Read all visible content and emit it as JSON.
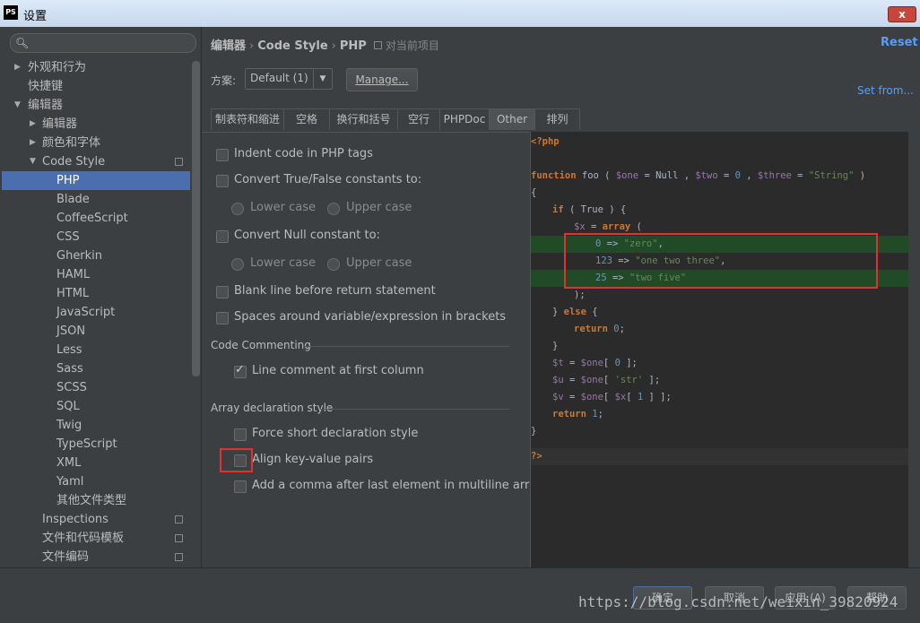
{
  "window": {
    "title": "设置",
    "app_icon": "PS",
    "close_label": "x"
  },
  "sidebar": {
    "search_placeholder": "",
    "items": [
      {
        "label": "外观和行为",
        "arrow": "▶"
      },
      {
        "label": "快捷键"
      },
      {
        "label": "编辑器",
        "arrow": "▼"
      },
      {
        "label": "编辑器",
        "arrow": "▶"
      },
      {
        "label": "颜色和字体",
        "arrow": "▶"
      },
      {
        "label": "Code Style",
        "arrow": "▼"
      },
      {
        "label": "PHP"
      },
      {
        "label": "Blade"
      },
      {
        "label": "CoffeeScript"
      },
      {
        "label": "CSS"
      },
      {
        "label": "Gherkin"
      },
      {
        "label": "HAML"
      },
      {
        "label": "HTML"
      },
      {
        "label": "JavaScript"
      },
      {
        "label": "JSON"
      },
      {
        "label": "Less"
      },
      {
        "label": "Sass"
      },
      {
        "label": "SCSS"
      },
      {
        "label": "SQL"
      },
      {
        "label": "Twig"
      },
      {
        "label": "TypeScript"
      },
      {
        "label": "XML"
      },
      {
        "label": "Yaml"
      },
      {
        "label": "其他文件类型"
      },
      {
        "label": "Inspections"
      },
      {
        "label": "文件和代码模板"
      },
      {
        "label": "文件编码"
      }
    ]
  },
  "header": {
    "crumb1": "编辑器",
    "crumb2": "Code Style",
    "crumb3": "PHP",
    "project": "对当前项目",
    "reset": "Reset",
    "scheme_label": "方案:",
    "scheme_value": "Default (1)",
    "manage": "Manage...",
    "set_from": "Set from..."
  },
  "tabs": [
    "制表符和缩进",
    "空格",
    "换行和括号",
    "空行",
    "PHPDoc",
    "Other",
    "排列"
  ],
  "options": {
    "indent_php_tags": "Indent code in PHP tags",
    "convert_true_false": "Convert True/False constants to:",
    "lower_case": "Lower case",
    "upper_case": "Upper case",
    "convert_null": "Convert Null constant to:",
    "blank_line_return": "Blank line before return statement",
    "spaces_around": "Spaces around variable/expression in brackets",
    "code_commenting": "Code Commenting",
    "line_comment_first": "Line comment at first column",
    "array_decl_style": "Array declaration style",
    "force_short": "Force short declaration style",
    "align_kv": "Align key-value pairs",
    "add_comma": "Add a comma after last element in multiline array"
  },
  "code": {
    "open_tag": "<?php",
    "close_tag": "?>",
    "l_function": "function",
    "l_foo": " foo ( ",
    "l_one": "$one",
    "l_eq_null": " = Null , ",
    "l_two": "$two",
    "l_eq0": " = ",
    "l_0a": "0",
    "l_comma": " , ",
    "l_three": "$three",
    "l_eq": " = ",
    "l_strS": "\"String\"",
    "l_close": " )",
    "brace_open": "{",
    "brace_close": "}",
    "l_if": "if",
    "l_if_cond": " ( True ) {",
    "l_x": "$x",
    "l_arr_eq": " = ",
    "l_array": "array",
    "l_paren": " (",
    "k0": "0",
    "k123": "123",
    "k25": "25",
    "arrow": " => ",
    "s_zero": "\"zero\"",
    "s_onetwothree": "\"one two three\"",
    "s_twofive": "\"two five\"",
    "comma": ",",
    "l_close_arr": ");",
    "l_else_pre": "} ",
    "l_else": "else",
    "l_else_post": " {",
    "l_return": "return",
    "l_ret0_num": "0",
    "semi": ";",
    "l_inner_close": "}",
    "l_t": "$t",
    "l_u": "$u",
    "l_v": "$v",
    "l_one_b": "$one",
    "l_idx0_pre": "[ ",
    "l_idx0": "0",
    "l_idx_post": " ];",
    "l_str_key": "'str'",
    "l_idx_str_pre": "[ ",
    "l_idx_str_post": " ];",
    "l_xref": "$x",
    "l_idx1_pre": "[ ",
    "l_idx1": "1",
    "l_idx1_post": " ] ];",
    "l_v_idx_pre": "[ ",
    "l_ret1": "1"
  },
  "buttons": {
    "ok": "确定",
    "cancel": "取消",
    "apply": "应用 (A)",
    "help": "帮助"
  },
  "watermark": "https://blog.csdn.net/weixin_39820924"
}
